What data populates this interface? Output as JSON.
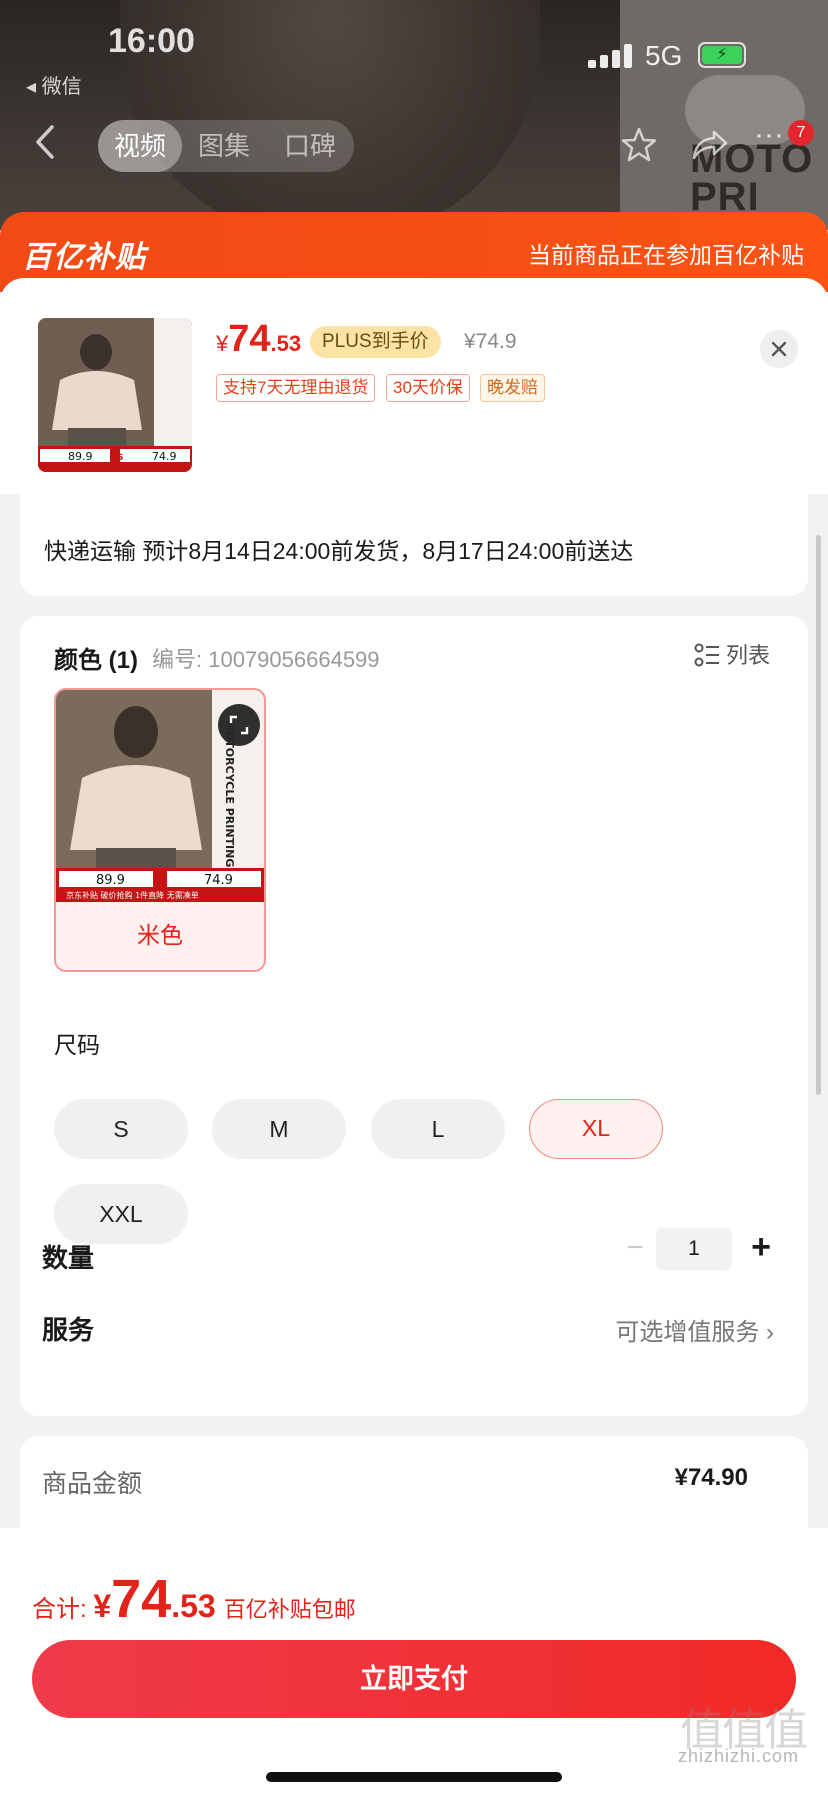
{
  "status_bar": {
    "time": "16:00",
    "back_app": "◂ 微信",
    "network": "5G"
  },
  "top_nav": {
    "tabs": [
      "视频",
      "图集",
      "口碑"
    ],
    "active_tab": "视频",
    "cart_badge": "7",
    "poster_text": "MOTO PRI"
  },
  "subsidy_banner": {
    "logo": "百亿补贴",
    "note": "当前商品正在参加百亿补贴"
  },
  "product_header": {
    "price_symbol": "¥",
    "price_int": "74",
    "price_dec": ".53",
    "plus_label": "PLUS到手价",
    "original_price": "¥74.9",
    "tags": [
      "支持7天无理由退货",
      "30天价保",
      "晚发赔"
    ],
    "thumb_prices": [
      "89.9",
      "74.9"
    ]
  },
  "shipping": {
    "text": "快递运输 预计8月14日24:00前发货，8月17日24:00前送达"
  },
  "color_section": {
    "title": "颜色 (1)",
    "code_label": "编号: 10079056664599",
    "list_toggle": "列表",
    "options": [
      {
        "name": "米色",
        "selected": true,
        "tile_text": "MOTORCYCLE PRINTING TEE",
        "tile_prices": [
          "89.9",
          "74.9"
        ],
        "tile_footer": "京东补贴   破价抢购   1件直降   无需凑单"
      }
    ]
  },
  "size_section": {
    "title": "尺码",
    "options": [
      "S",
      "M",
      "L",
      "XL",
      "XXL"
    ],
    "selected": "XL"
  },
  "quantity": {
    "label": "数量",
    "minus": "−",
    "value": "1",
    "plus": "+"
  },
  "service": {
    "label": "服务",
    "value": "可选增值服务 ›"
  },
  "amount": {
    "label": "商品金额",
    "value": "¥74.90"
  },
  "footer": {
    "total_label": "合计: ",
    "total_symbol": "¥",
    "total_int": "74",
    "total_dec": ".53",
    "total_note": "百亿补贴包邮",
    "pay_button": "立即支付",
    "watermark": "zhizhizhi.com",
    "watermark_logo": "值值值"
  },
  "colors": {
    "accent_red": "#e2231a",
    "banner_orange": "#f04a16",
    "plus_gold": "#fbe3a6"
  }
}
